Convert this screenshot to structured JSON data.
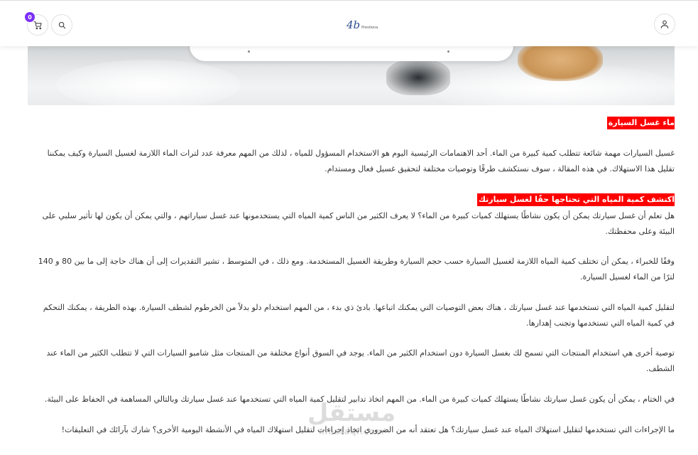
{
  "header": {
    "cart_count": "0",
    "logo_mark": "4b",
    "logo_sub": "Prestiona"
  },
  "article": {
    "heading1": "ماء غسل السيارة",
    "para1": [
      "غسيل السيارات مهمة شائعة تتطلب كمية كبيرة من الماء. أحد الاهتمامات الرئيسية اليوم هو الاستخدام المسؤول للمياه ، لذلك من المهم معرفة عدد لترات الماء اللازمة لغسيل السيارة وكيف يمكننا",
      "تقليل هذا الاستهلاك. في هذه المقالة ، سوف نستكشف طرقًا وتوصيات مختلفة لتحقيق غسيل فعال ومستدام."
    ],
    "heading2": "اكتشف كمية المياه التي تحتاجها حقًا لغسل سيارتك",
    "para2": [
      "هل تعلم أن غسل سيارتك يمكن أن يكون نشاطًا يستهلك كميات كبيرة من الماء؟ لا يعرف الكثير من الناس كمية المياه التي يستخدمونها عند غسل سياراتهم ، والتي يمكن أن يكون لها تأثير سلبي على",
      "البيئة وعلى محفظتك."
    ],
    "para3": [
      "وفقًا للخبراء ، يمكن أن تختلف كمية المياه اللازمة لغسيل السيارة حسب حجم السيارة وطريقة الغسيل المستخدمة. ومع ذلك ، في المتوسط ، تشير التقديرات إلى أن هناك حاجة إلى ما بين 80 و 140",
      "لترًا من الماء لغسيل السيارة."
    ],
    "para4": [
      "لتقليل كمية المياه التي تستخدمها عند غسل سيارتك ، هناك بعض التوصيات التي يمكنك اتباعها. بادئ ذي بدء ، من المهم استخدام دلو بدلاً من الخرطوم لشطف السيارة. بهذه الطريقة ، يمكنك التحكم",
      "في كمية المياه التي تستخدمها وتجنب إهدارها."
    ],
    "para5": [
      "توصية أخرى هي استخدام المنتجات التي تسمح لك بغسل السيارة دون استخدام الكثير من الماء. يوجد في السوق أنواع مختلفة من المنتجات مثل شامبو السيارات التي لا تتطلب الكثير من الماء عند",
      "الشطف."
    ],
    "para6": [
      "في الختام ، يمكن أن يكون غسل سيارتك نشاطًا يستهلك كميات كبيرة من الماء. من المهم اتخاذ تدابير لتقليل كمية المياه التي تستخدمها عند غسل سيارتك وبالتالي المساهمة في الحفاظ على البيئة."
    ],
    "para7": [
      "ما الإجراءات التي تستخدمها لتقليل استهلاك المياه عند غسل سيارتك؟ هل تعتقد أنه من الضروري اتخاذ إجراءات لتقليل استهلاك المياه في الأنشطة اليومية الأخرى؟ شارك بآرائك في التعليقات!"
    ]
  },
  "watermark": {
    "text_ar": "مستقل",
    "text_en": "mostaql.com"
  },
  "colors": {
    "highlight": "#ff0000",
    "badge": "#7b2ff7"
  }
}
